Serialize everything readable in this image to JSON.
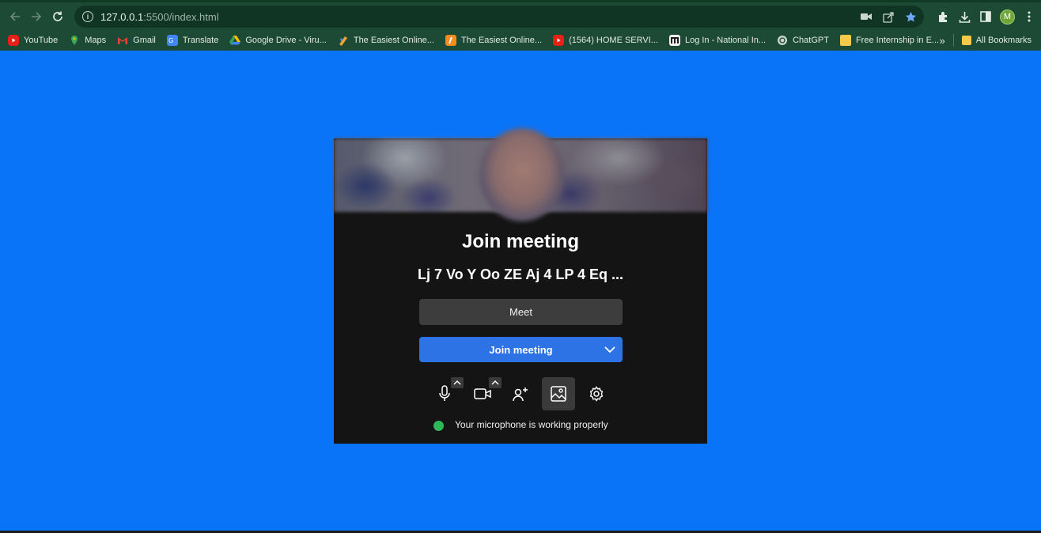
{
  "browser": {
    "url_host": "127.0.0.1",
    "url_path": ":5500/index.html",
    "profile_initial": "M",
    "bookmarks": [
      {
        "label": "YouTube",
        "icon": "youtube-icon",
        "color": "#e62117"
      },
      {
        "label": "Maps",
        "icon": "maps-icon",
        "color": "#34a853"
      },
      {
        "label": "Gmail",
        "icon": "gmail-icon",
        "color": "#ea4335"
      },
      {
        "label": "Translate",
        "icon": "translate-icon",
        "color": "#4285f4"
      },
      {
        "label": "Google Drive - Viru...",
        "icon": "google-drive-icon",
        "color": "#fbbc04"
      },
      {
        "label": "The Easiest Online...",
        "icon": "easiest-online-icon",
        "color": "#f4a32b"
      },
      {
        "label": "The Easiest Online...",
        "icon": "easiest-online-icon",
        "color": "#f48c1e"
      },
      {
        "label": "(1564) HOME SERVI...",
        "icon": "youtube-icon",
        "color": "#e62117"
      },
      {
        "label": "Log In - National In...",
        "icon": "nimbus-icon",
        "color": "#ffffff"
      },
      {
        "label": "ChatGPT",
        "icon": "chatgpt-icon",
        "color": "#c9d4cf"
      },
      {
        "label": "Free Internship in E...",
        "icon": "folder-icon",
        "color": "#f5c949"
      }
    ],
    "more_bookmarks": "»",
    "all_bookmarks": "All Bookmarks"
  },
  "meeting": {
    "title": "Join meeting",
    "code": "Lj 7 Vo Y Oo ZE Aj 4 LP 4 Eq ...",
    "meet_button": "Meet",
    "join_button": "Join meeting",
    "status_text": "Your microphone is working properly",
    "status_color": "#2fb85a",
    "controls": [
      "microphone-icon",
      "camera-icon",
      "add-person-icon",
      "background-image-icon",
      "settings-icon"
    ]
  },
  "colors": {
    "page_bg": "#0a74f8",
    "card_bg": "#141414",
    "join_blue": "#2d73e6"
  }
}
